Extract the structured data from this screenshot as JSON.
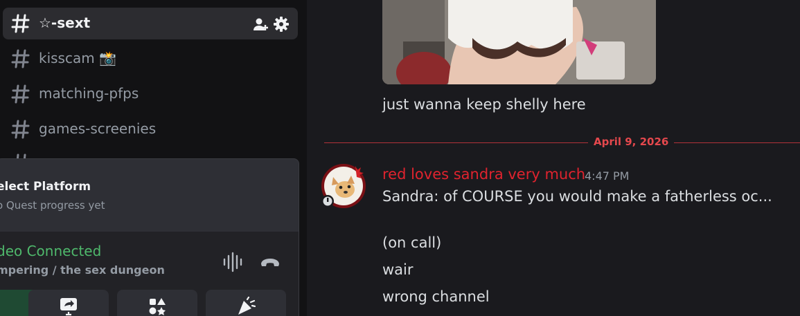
{
  "sidebar": {
    "channels": [
      {
        "name": "☆-sext",
        "active": true
      },
      {
        "name": "kisscam 📸",
        "active": false
      },
      {
        "name": "matching-pfps",
        "active": false
      },
      {
        "name": "games-screenies",
        "active": false
      }
    ],
    "active_channel_icons": [
      "invite-member-icon",
      "settings-gear-icon"
    ]
  },
  "quest_panel": {
    "title": "elect Platform",
    "subtitle": "o Quest progress yet"
  },
  "voice_panel": {
    "status": "deo Connected",
    "location": "mpering / the sex dungeon",
    "icons": [
      "noise-suppression-icon",
      "disconnect-call-icon"
    ],
    "action_buttons": [
      "video-icon",
      "screen-share-icon",
      "activities-icon",
      "soundboard-icon"
    ],
    "colors": {
      "connected": "#4fb96c",
      "panel": "#222226"
    }
  },
  "chat": {
    "previous_message_text": "just wanna keep shelly here",
    "date_divider": "April 9, 2026",
    "message": {
      "author": "red loves sandra very much",
      "author_color": "#e0232e",
      "timestamp": "4:47 PM",
      "lines": [
        "Sandra: of COURSE you would make a fatherless oc...",
        "(on call)",
        "wair",
        "wrong channel"
      ]
    }
  }
}
